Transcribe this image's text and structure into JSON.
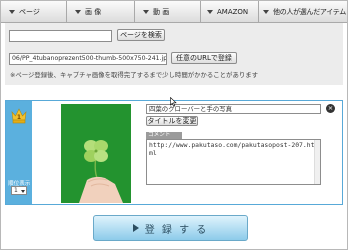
{
  "tabs": [
    {
      "label": "ページ"
    },
    {
      "label": "画 像"
    },
    {
      "label": "動 画"
    },
    {
      "label": "AMAZON"
    },
    {
      "label": "他の人が選んだアイテム"
    }
  ],
  "search": {
    "url_value": "",
    "button_label": "ページを検索"
  },
  "register": {
    "file_value": "06/PP_4tubanoprezent500-thumb-500x750-241.jpg",
    "button_label": "任意のURLで登録",
    "note": "※ページ登録後、キャプチャ画像を取得完了するまで少し時間がかかることがあります"
  },
  "item": {
    "rank_number": "1",
    "rank_label": "順位表示",
    "rank_value": "1",
    "title_value": "四葉のクローバーと手の写真",
    "title_button": "タイトルを変更",
    "comment_label": "コメント",
    "comment_value": "http://www.pakutaso.com/pakutasopost-207.html",
    "close_label": "×"
  },
  "submit": {
    "label": "登 録 す る"
  },
  "colors": {
    "accent_blue": "#5bb0de",
    "crown_gold": "#f2c12e",
    "photo_green": "#1f8a2b"
  }
}
